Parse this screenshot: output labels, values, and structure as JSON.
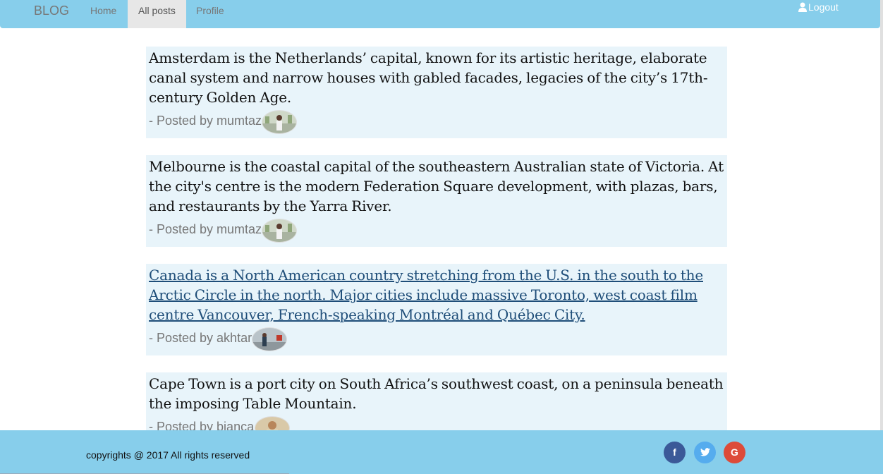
{
  "navbar": {
    "brand": "BLOG",
    "links": [
      "Home",
      "All posts",
      "Profile"
    ],
    "logout": "Logout"
  },
  "posts": [
    {
      "text": "Amsterdam is the Netherlands’ capital, known for its artistic heritage, elaborate canal system and narrow houses with gabled facades, legacies of the city’s 17th-century Golden Age.",
      "byline": "- Posted by mumtaz",
      "is_link": false
    },
    {
      "text": "Melbourne is the coastal capital of the southeastern Australian state of Victoria. At the city's centre is the modern Federation Square development, with plazas, bars, and restaurants by the Yarra River.",
      "byline": "- Posted by mumtaz",
      "is_link": false
    },
    {
      "text": "Canada is a North American country stretching from the U.S. in the south to the Arctic Circle in the north. Major cities include massive Toronto, west coast film centre Vancouver, French-speaking Montréal and Québec City.",
      "byline": "- Posted by akhtar",
      "is_link": true
    },
    {
      "text": "Cape Town is a port city on South Africa’s southwest coast, on a peninsula beneath the imposing Table Mountain.",
      "byline": "- Posted by bianca",
      "is_link": false
    }
  ],
  "footer": {
    "copyright": "copyrights @ 2017 All rights reserved",
    "social": [
      {
        "icon": "facebook-icon",
        "glyph": "f",
        "color": "#3b5998"
      },
      {
        "icon": "twitter-icon",
        "glyph": "t",
        "color": "#55acee"
      },
      {
        "icon": "google-icon",
        "glyph": "G",
        "color": "#dd4b39"
      }
    ]
  },
  "colors": {
    "navbar": "#87ceeb",
    "post_bg": "#e8f4fa",
    "link": "#1f4e79"
  }
}
